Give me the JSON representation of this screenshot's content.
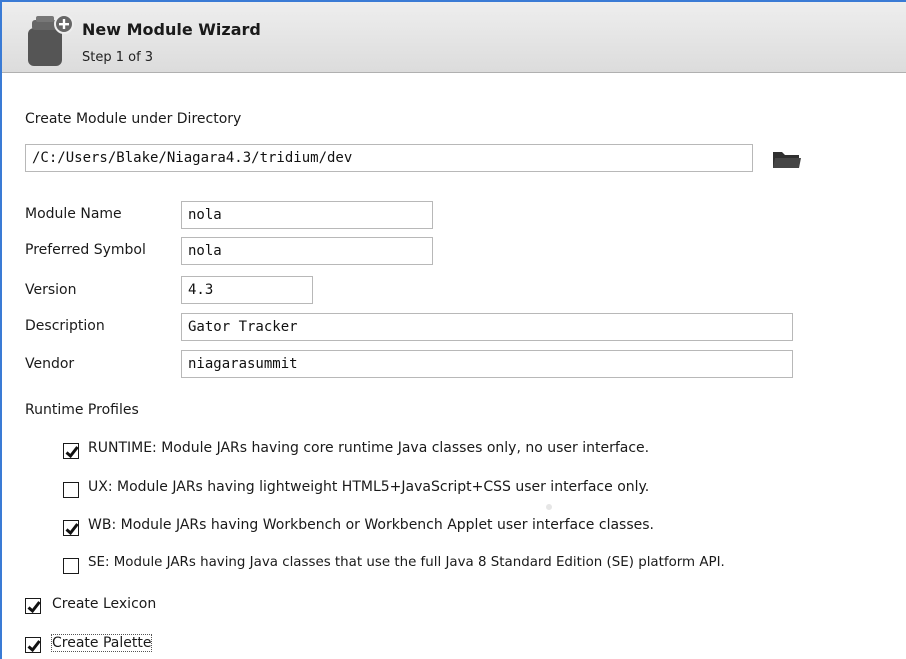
{
  "window": {
    "title": "New Module Wizard",
    "step": "Step 1 of 3"
  },
  "directory": {
    "label": "Create Module under Directory",
    "value": "/C:/Users/Blake/Niagara4.3/tridium/dev",
    "browse_icon": "folder-icon"
  },
  "fields": {
    "module_name": {
      "label": "Module Name",
      "value": "nola"
    },
    "preferred_symbol": {
      "label": "Preferred Symbol",
      "value": "nola"
    },
    "version": {
      "label": "Version",
      "value": "4.3"
    },
    "description": {
      "label": "Description",
      "value": "Gator Tracker"
    },
    "vendor": {
      "label": "Vendor",
      "value": "niagarasummit"
    }
  },
  "runtime_profiles": {
    "label": "Runtime Profiles",
    "items": [
      {
        "text": "RUNTIME: Module JARs having core runtime Java classes only, no user interface.",
        "checked": true
      },
      {
        "text": "UX: Module JARs having lightweight HTML5+JavaScript+CSS user interface only.",
        "checked": false
      },
      {
        "text": "WB: Module JARs having Workbench or Workbench Applet user interface classes.",
        "checked": true
      },
      {
        "text": "SE: Module JARs having Java classes that use the full Java 8 Standard Edition (SE) platform API.",
        "checked": false
      }
    ]
  },
  "options": {
    "create_lexicon": {
      "label": "Create Lexicon",
      "checked": true
    },
    "create_palette": {
      "label": "Create Palette",
      "checked": true
    }
  },
  "colors": {
    "accent_border": "#3a7bd5",
    "header_bg": "#e4e4e4"
  }
}
